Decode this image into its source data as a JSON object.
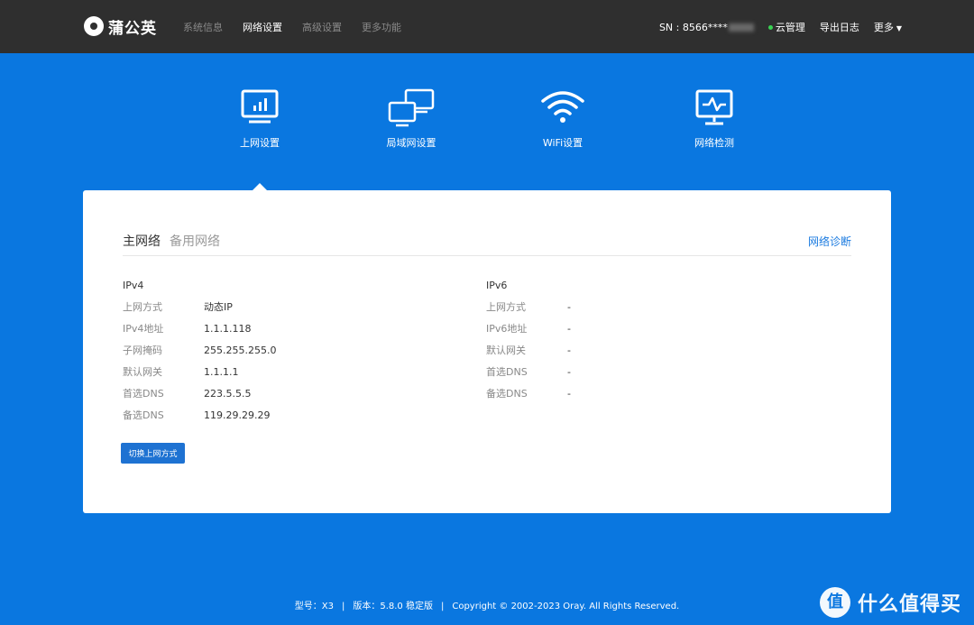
{
  "app": {
    "logo_text": "蒲公英"
  },
  "nav": {
    "items": [
      {
        "label": "系统信息"
      },
      {
        "label": "网络设置"
      },
      {
        "label": "高级设置"
      },
      {
        "label": "更多功能"
      }
    ],
    "active": "网络设置"
  },
  "header_right": {
    "sn_prefix": "SN : 8566****",
    "cloud": "云管理",
    "export_log": "导出日志",
    "more": "更多"
  },
  "features": [
    {
      "label": "上网设置",
      "icon": "monitor-chart-icon"
    },
    {
      "label": "局域网设置",
      "icon": "two-monitors-icon"
    },
    {
      "label": "WiFi设置",
      "icon": "wifi-icon"
    },
    {
      "label": "网络检测",
      "icon": "monitor-pulse-icon"
    }
  ],
  "card": {
    "tabs": [
      {
        "label": "主网络",
        "active": true
      },
      {
        "label": "备用网络",
        "active": false
      }
    ],
    "diagnose_link": "网络诊断",
    "ipv4": {
      "title": "IPv4",
      "rows": [
        {
          "label": "上网方式",
          "value": "动态IP"
        },
        {
          "label": "IPv4地址",
          "value": "1.1.1.118"
        },
        {
          "label": "子网掩码",
          "value": "255.255.255.0"
        },
        {
          "label": "默认网关",
          "value": "1.1.1.1"
        },
        {
          "label": "首选DNS",
          "value": "223.5.5.5"
        },
        {
          "label": "备选DNS",
          "value": "119.29.29.29"
        }
      ]
    },
    "ipv6": {
      "title": "IPv6",
      "rows": [
        {
          "label": "上网方式",
          "value": "-"
        },
        {
          "label": "IPv6地址",
          "value": "-"
        },
        {
          "label": "默认网关",
          "value": "-"
        },
        {
          "label": "首选DNS",
          "value": "-"
        },
        {
          "label": "备选DNS",
          "value": "-"
        }
      ]
    },
    "switch_button": "切换上网方式"
  },
  "footer": {
    "model": "型号：X3",
    "version": "版本：5.8.0 稳定版",
    "copyright": "Copyright © 2002-2023 Oray. All Rights Reserved."
  },
  "watermark": {
    "icon": "值",
    "text": "什么值得买"
  },
  "colors": {
    "background": "#0a77e0",
    "header": "#2f2f2f",
    "accent": "#1e72d2",
    "link": "#1b7be0",
    "status_online": "#39d353"
  }
}
